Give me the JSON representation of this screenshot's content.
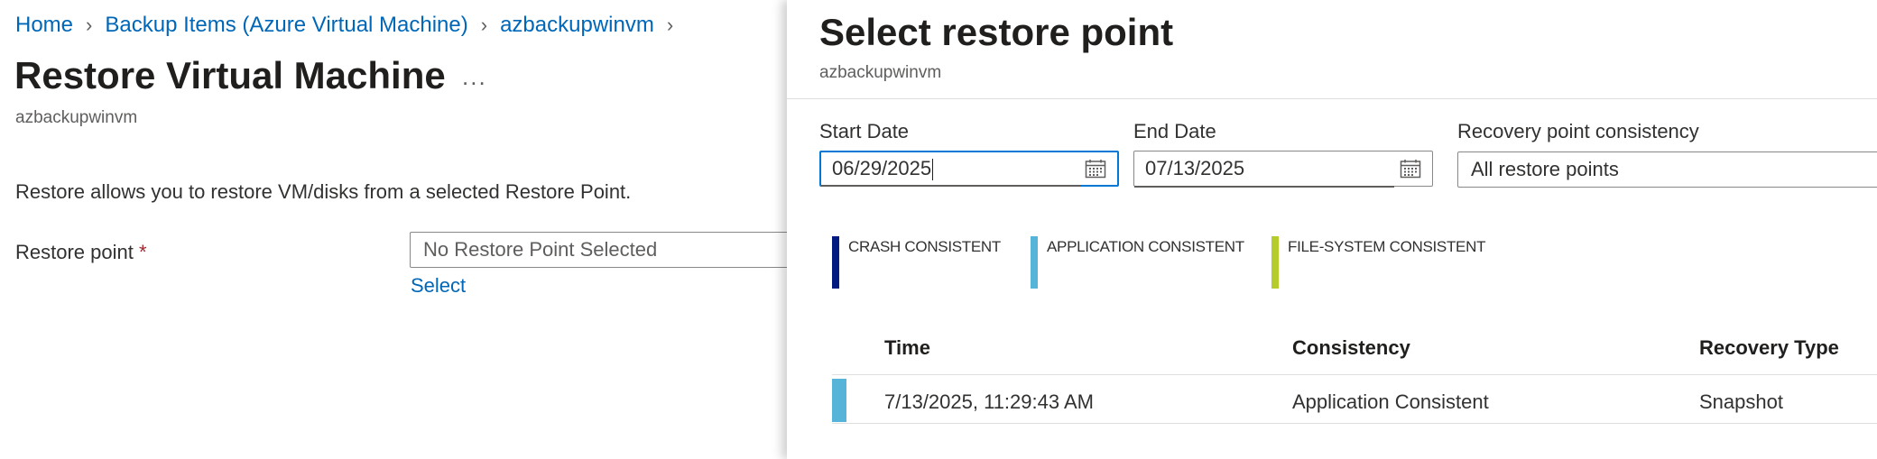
{
  "breadcrumb": [
    {
      "label": "Home"
    },
    {
      "label": "Backup Items (Azure Virtual Machine)"
    },
    {
      "label": "azbackupwinvm"
    }
  ],
  "left": {
    "title": "Restore Virtual Machine",
    "more": "...",
    "subtitle": "azbackupwinvm",
    "description": "Restore allows you to restore VM/disks from a selected Restore Point.",
    "restore_point_label": "Restore point",
    "required_marker": "*",
    "restore_point_value": "No Restore Point Selected",
    "select_link": "Select"
  },
  "panel": {
    "title": "Select restore point",
    "subtitle": "azbackupwinvm",
    "start_date_label": "Start Date",
    "start_date_value": "06/29/2025",
    "end_date_label": "End Date",
    "end_date_value": "07/13/2025",
    "consistency_label": "Recovery point consistency",
    "consistency_value": "All restore points",
    "legend": [
      {
        "label": "CRASH CONSISTENT",
        "color": "#001a80"
      },
      {
        "label": "APPLICATION CONSISTENT",
        "color": "#56b4d9"
      },
      {
        "label": "FILE-SYSTEM CONSISTENT",
        "color": "#b5cc2c"
      }
    ],
    "table": {
      "headers": [
        "Time",
        "Consistency",
        "Recovery Type"
      ],
      "rows": [
        {
          "time": "7/13/2025, 11:29:43 AM",
          "consistency": "Application Consistent",
          "recovery_type": "Snapshot",
          "color": "#56b4d9"
        }
      ]
    }
  },
  "icons": {
    "breadcrumb_separator": "chevron-right-icon",
    "date_picker": "calendar-icon"
  }
}
